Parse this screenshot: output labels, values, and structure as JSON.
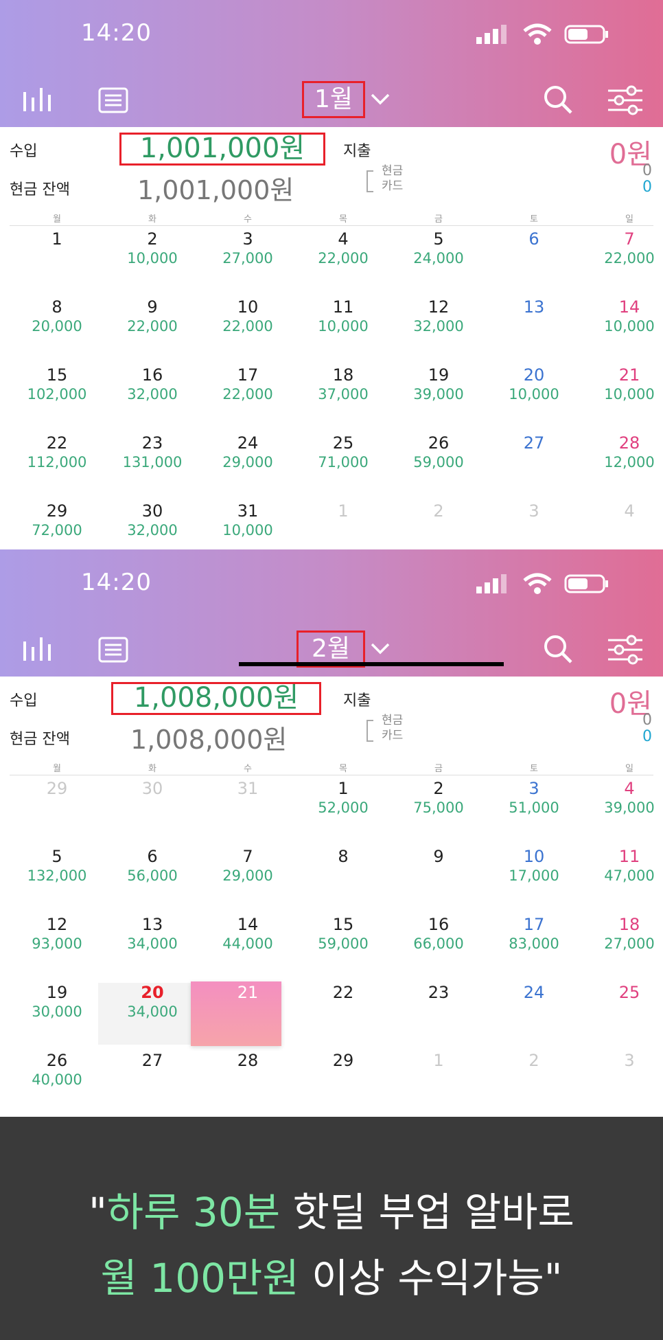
{
  "status": {
    "time": "14:20"
  },
  "screens": [
    {
      "month_label": "1월",
      "income_label": "수입",
      "income_value": "1,001,000원",
      "expense_label": "지출",
      "expense_value": "0원",
      "balance_label": "현금 잔액",
      "balance_value": "1,001,000원",
      "cash_label": "현금",
      "card_label": "카드",
      "cash_value": "0",
      "card_value": "0",
      "weekdays": [
        "월",
        "화",
        "수",
        "목",
        "금",
        "토",
        "일"
      ],
      "days": [
        {
          "d": "1",
          "a": "",
          "t": "n"
        },
        {
          "d": "2",
          "a": "10,000",
          "t": "n"
        },
        {
          "d": "3",
          "a": "27,000",
          "t": "n"
        },
        {
          "d": "4",
          "a": "22,000",
          "t": "n"
        },
        {
          "d": "5",
          "a": "24,000",
          "t": "n"
        },
        {
          "d": "6",
          "a": "",
          "t": "sat"
        },
        {
          "d": "7",
          "a": "22,000",
          "t": "sun"
        },
        {
          "d": "8",
          "a": "20,000",
          "t": "n"
        },
        {
          "d": "9",
          "a": "22,000",
          "t": "n"
        },
        {
          "d": "10",
          "a": "22,000",
          "t": "n"
        },
        {
          "d": "11",
          "a": "10,000",
          "t": "n"
        },
        {
          "d": "12",
          "a": "32,000",
          "t": "n"
        },
        {
          "d": "13",
          "a": "",
          "t": "sat"
        },
        {
          "d": "14",
          "a": "10,000",
          "t": "sun"
        },
        {
          "d": "15",
          "a": "102,000",
          "t": "n"
        },
        {
          "d": "16",
          "a": "32,000",
          "t": "n"
        },
        {
          "d": "17",
          "a": "22,000",
          "t": "n"
        },
        {
          "d": "18",
          "a": "37,000",
          "t": "n"
        },
        {
          "d": "19",
          "a": "39,000",
          "t": "n"
        },
        {
          "d": "20",
          "a": "10,000",
          "t": "sat"
        },
        {
          "d": "21",
          "a": "10,000",
          "t": "sun"
        },
        {
          "d": "22",
          "a": "112,000",
          "t": "n"
        },
        {
          "d": "23",
          "a": "131,000",
          "t": "n"
        },
        {
          "d": "24",
          "a": "29,000",
          "t": "n"
        },
        {
          "d": "25",
          "a": "71,000",
          "t": "n"
        },
        {
          "d": "26",
          "a": "59,000",
          "t": "n"
        },
        {
          "d": "27",
          "a": "",
          "t": "sat"
        },
        {
          "d": "28",
          "a": "12,000",
          "t": "sun"
        },
        {
          "d": "29",
          "a": "72,000",
          "t": "n"
        },
        {
          "d": "30",
          "a": "32,000",
          "t": "n"
        },
        {
          "d": "31",
          "a": "10,000",
          "t": "n"
        },
        {
          "d": "1",
          "a": "",
          "t": "dim"
        },
        {
          "d": "2",
          "a": "",
          "t": "dim"
        },
        {
          "d": "3",
          "a": "",
          "t": "dim"
        },
        {
          "d": "4",
          "a": "",
          "t": "dim"
        }
      ]
    },
    {
      "month_label": "2월",
      "income_label": "수입",
      "income_value": "1,008,000원",
      "expense_label": "지출",
      "expense_value": "0원",
      "balance_label": "현금 잔액",
      "balance_value": "1,008,000원",
      "cash_label": "현금",
      "card_label": "카드",
      "cash_value": "0",
      "card_value": "0",
      "weekdays": [
        "월",
        "화",
        "수",
        "목",
        "금",
        "토",
        "일"
      ],
      "days": [
        {
          "d": "29",
          "a": "",
          "t": "dim"
        },
        {
          "d": "30",
          "a": "",
          "t": "dim"
        },
        {
          "d": "31",
          "a": "",
          "t": "dim"
        },
        {
          "d": "1",
          "a": "52,000",
          "t": "n"
        },
        {
          "d": "2",
          "a": "75,000",
          "t": "n"
        },
        {
          "d": "3",
          "a": "51,000",
          "t": "sat"
        },
        {
          "d": "4",
          "a": "39,000",
          "t": "sun"
        },
        {
          "d": "5",
          "a": "132,000",
          "t": "n"
        },
        {
          "d": "6",
          "a": "56,000",
          "t": "n"
        },
        {
          "d": "7",
          "a": "29,000",
          "t": "n"
        },
        {
          "d": "8",
          "a": "",
          "t": "n"
        },
        {
          "d": "9",
          "a": "",
          "t": "n"
        },
        {
          "d": "10",
          "a": "17,000",
          "t": "sat"
        },
        {
          "d": "11",
          "a": "47,000",
          "t": "sun"
        },
        {
          "d": "12",
          "a": "93,000",
          "t": "n"
        },
        {
          "d": "13",
          "a": "34,000",
          "t": "n"
        },
        {
          "d": "14",
          "a": "44,000",
          "t": "n"
        },
        {
          "d": "15",
          "a": "59,000",
          "t": "n"
        },
        {
          "d": "16",
          "a": "66,000",
          "t": "n"
        },
        {
          "d": "17",
          "a": "83,000",
          "t": "sat"
        },
        {
          "d": "18",
          "a": "27,000",
          "t": "sun"
        },
        {
          "d": "19",
          "a": "30,000",
          "t": "n"
        },
        {
          "d": "20",
          "a": "34,000",
          "t": "today"
        },
        {
          "d": "21",
          "a": "",
          "t": "sel"
        },
        {
          "d": "22",
          "a": "",
          "t": "n"
        },
        {
          "d": "23",
          "a": "",
          "t": "n"
        },
        {
          "d": "24",
          "a": "",
          "t": "sat"
        },
        {
          "d": "25",
          "a": "",
          "t": "sun"
        },
        {
          "d": "26",
          "a": "40,000",
          "t": "n"
        },
        {
          "d": "27",
          "a": "",
          "t": "n"
        },
        {
          "d": "28",
          "a": "",
          "t": "n"
        },
        {
          "d": "29",
          "a": "",
          "t": "n"
        },
        {
          "d": "1",
          "a": "",
          "t": "dim"
        },
        {
          "d": "2",
          "a": "",
          "t": "dim"
        },
        {
          "d": "3",
          "a": "",
          "t": "dim"
        }
      ]
    }
  ],
  "banner": {
    "line1_q": "\"",
    "line1_hl": "하루 30분",
    "line1_rest": " 핫딜 부업 알바로",
    "line2_hl": "월 100만원",
    "line2_rest": " 이상 수익가능\"",
    "highlight_color": "#7de6a4"
  },
  "icons": [
    "stats-icon",
    "list-icon",
    "chevron-down-icon",
    "search-icon",
    "filter-icon",
    "signal-icon",
    "wifi-icon",
    "battery-icon"
  ]
}
